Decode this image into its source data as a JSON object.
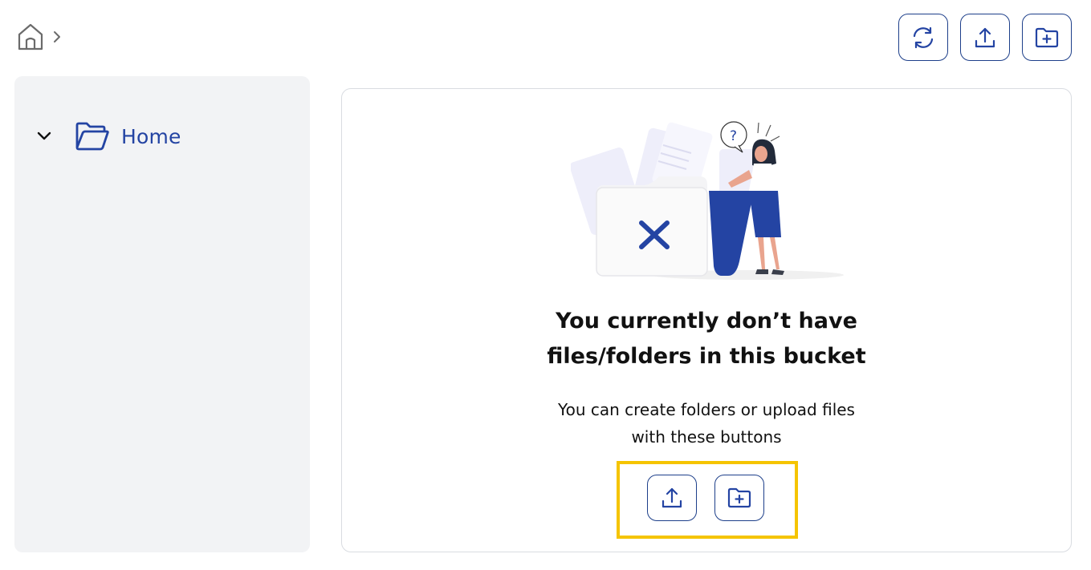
{
  "breadcrumb": {
    "home_icon": "home-icon",
    "separator_icon": "chevron-right-icon"
  },
  "toolbar": {
    "buttons": [
      {
        "name": "refresh-button",
        "icon": "refresh-icon"
      },
      {
        "name": "upload-button",
        "icon": "upload-icon"
      },
      {
        "name": "new-folder-button",
        "icon": "folder-plus-icon"
      }
    ]
  },
  "sidebar": {
    "tree": [
      {
        "label": "Home",
        "expanded": true,
        "icon": "folder-open-icon"
      }
    ]
  },
  "empty_state": {
    "title_line1": "You currently don’t have",
    "title_line2": "files/folders in this bucket",
    "desc_line1": "You can create folders or upload files",
    "desc_line2": "with these buttons",
    "actions": [
      {
        "name": "upload-button",
        "icon": "upload-icon"
      },
      {
        "name": "new-folder-button",
        "icon": "folder-plus-icon"
      }
    ]
  },
  "colors": {
    "accent": "#2444a3",
    "button_border": "#1d3f8a",
    "sidebar_bg": "#f2f3f5",
    "highlight": "#f5c400"
  }
}
